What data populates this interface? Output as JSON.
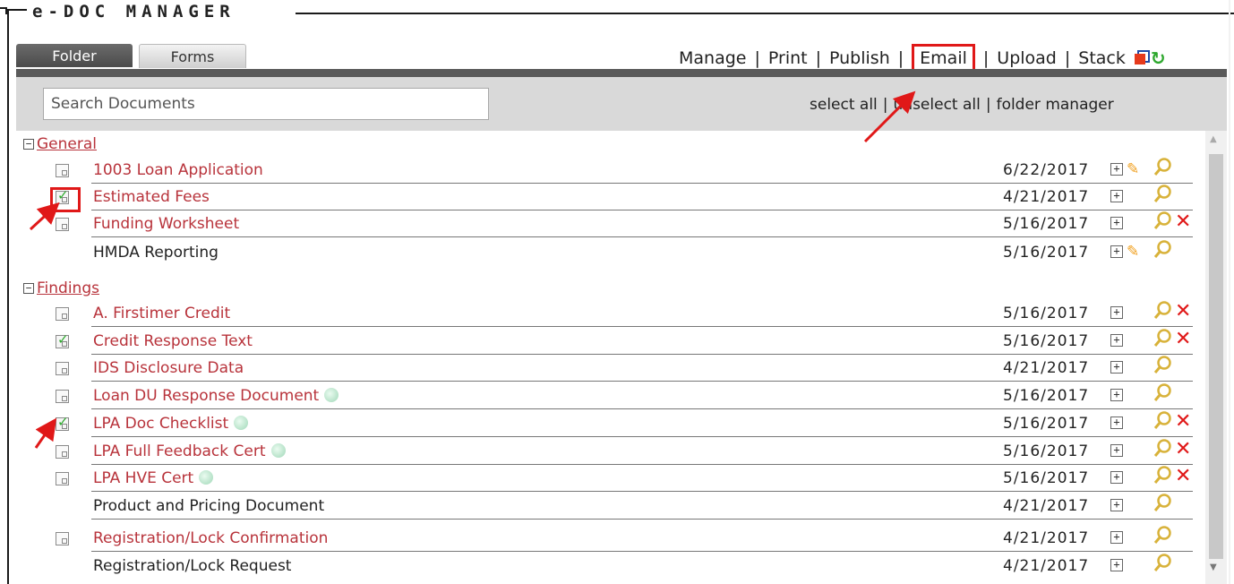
{
  "app": {
    "title": "e-DOC MANAGER"
  },
  "tabs": [
    {
      "label": "Folder",
      "active": true
    },
    {
      "label": "Forms",
      "active": false
    }
  ],
  "topnav": {
    "manage": "Manage",
    "print": "Print",
    "publish": "Publish",
    "email": "Email",
    "upload": "Upload",
    "stack": "Stack",
    "sep": "|",
    "stack_icon": "stack-window-icon",
    "refresh_icon": "refresh-icon"
  },
  "search": {
    "placeholder": "Search Documents",
    "value": ""
  },
  "selection": {
    "select_all": "select all",
    "unselect_all": "unselect all",
    "folder_manager": "folder manager",
    "sep": "|"
  },
  "groups": [
    {
      "name": "General",
      "docs": [
        {
          "name": "1003 Loan Application",
          "date": "6/22/2017",
          "checkbox": true,
          "checked": false,
          "status_dot": false,
          "edit": true,
          "delete": false,
          "style": "red"
        },
        {
          "name": "Estimated Fees",
          "date": "4/21/2017",
          "checkbox": true,
          "checked": true,
          "status_dot": false,
          "edit": false,
          "delete": false,
          "style": "red"
        },
        {
          "name": "Funding Worksheet",
          "date": "5/16/2017",
          "checkbox": true,
          "checked": false,
          "status_dot": false,
          "edit": false,
          "delete": true,
          "style": "red"
        },
        {
          "name": "HMDA Reporting",
          "date": "5/16/2017",
          "checkbox": false,
          "checked": false,
          "status_dot": false,
          "edit": true,
          "delete": false,
          "style": "black"
        }
      ]
    },
    {
      "name": "Findings",
      "docs": [
        {
          "name": "A. Firstimer Credit",
          "date": "5/16/2017",
          "checkbox": true,
          "checked": false,
          "status_dot": false,
          "edit": false,
          "delete": true,
          "style": "red"
        },
        {
          "name": "Credit Response Text",
          "date": "5/16/2017",
          "checkbox": true,
          "checked": true,
          "status_dot": false,
          "edit": false,
          "delete": true,
          "style": "red"
        },
        {
          "name": "IDS Disclosure Data",
          "date": "4/21/2017",
          "checkbox": true,
          "checked": false,
          "status_dot": false,
          "edit": false,
          "delete": false,
          "style": "red"
        },
        {
          "name": "Loan DU Response Document",
          "date": "5/16/2017",
          "checkbox": true,
          "checked": false,
          "status_dot": true,
          "edit": false,
          "delete": false,
          "style": "red"
        },
        {
          "name": "LPA Doc Checklist",
          "date": "5/16/2017",
          "checkbox": true,
          "checked": true,
          "status_dot": true,
          "edit": false,
          "delete": true,
          "style": "red"
        },
        {
          "name": "LPA Full Feedback Cert",
          "date": "5/16/2017",
          "checkbox": true,
          "checked": false,
          "status_dot": true,
          "edit": false,
          "delete": true,
          "style": "red"
        },
        {
          "name": "LPA HVE Cert",
          "date": "5/16/2017",
          "checkbox": true,
          "checked": false,
          "status_dot": true,
          "edit": false,
          "delete": true,
          "style": "red"
        },
        {
          "name": "Product and Pricing Document",
          "date": "4/21/2017",
          "checkbox": false,
          "checked": false,
          "status_dot": false,
          "edit": false,
          "delete": false,
          "style": "black"
        },
        {
          "name": "Registration/Lock Confirmation",
          "date": "4/21/2017",
          "checkbox": true,
          "checked": false,
          "status_dot": false,
          "edit": false,
          "delete": false,
          "style": "red"
        },
        {
          "name": "Registration/Lock Request",
          "date": "4/21/2017",
          "checkbox": false,
          "checked": false,
          "status_dot": false,
          "edit": false,
          "delete": false,
          "style": "black"
        }
      ]
    }
  ],
  "icons": {
    "expand": "plus-box-icon",
    "collapse": "minus-box-icon",
    "edit": "pencil-icon",
    "view": "magnifier-icon",
    "delete": "delete-x-icon",
    "doc": "document-checkbox-icon"
  },
  "colors": {
    "link_red": "#b8333b",
    "tab_active": "#5a5a5a",
    "annotation_red": "#e01818",
    "check_green": "#2eaa2e",
    "status_dot": "#9fd7b7"
  }
}
